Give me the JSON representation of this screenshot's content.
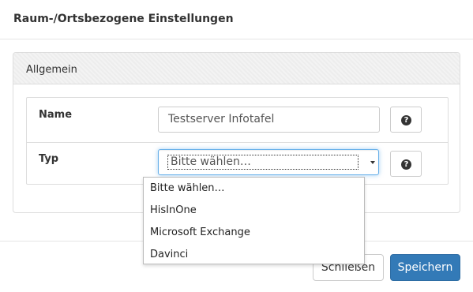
{
  "modal": {
    "title": "Raum-/Ortsbezogene Einstellungen"
  },
  "panel": {
    "heading": "Allgemein"
  },
  "form": {
    "name_label": "Name",
    "name_value": "Testserver Infotafel",
    "type_label": "Typ",
    "type_selected": "Bitte wählen…",
    "help_icon": "question-circle-icon"
  },
  "dropdown": {
    "options": [
      "Bitte wählen…",
      "HisInOne",
      "Microsoft Exchange",
      "Davinci"
    ]
  },
  "footer": {
    "close_label": "Schließen",
    "save_label": "Speichern"
  },
  "colors": {
    "primary": "#337ab7",
    "focus_border": "#66afe9"
  }
}
